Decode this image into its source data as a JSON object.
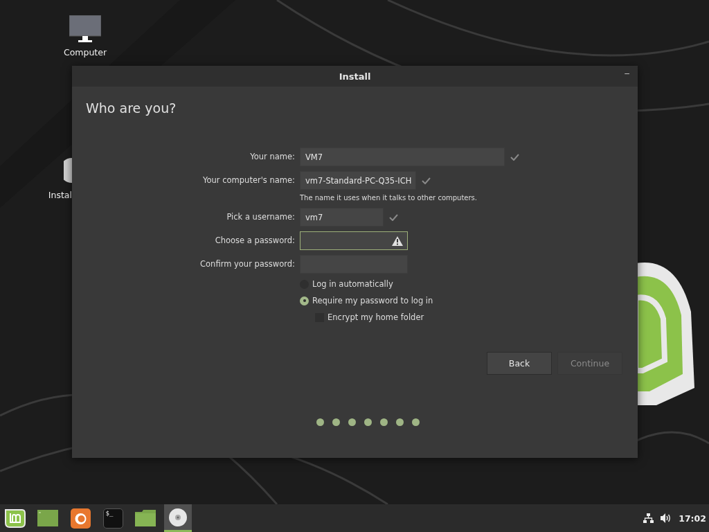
{
  "desktop_icons": [
    {
      "label": "Computer",
      "kind": "computer"
    },
    {
      "label": "Instal",
      "kind": "disc"
    }
  ],
  "window": {
    "title": "Install",
    "minimize": "–",
    "heading": "Who are you?",
    "fields": [
      {
        "label": "Your name:",
        "value": "VM7",
        "valid": true,
        "warning": false,
        "focused": false
      },
      {
        "label": "Your computer's name:",
        "value": "vm7-Standard-PC-Q35-ICH",
        "valid": true,
        "warning": false,
        "focused": false,
        "hint": "The name it uses when it talks to other computers."
      },
      {
        "label": "Pick a username:",
        "value": "vm7",
        "valid": true,
        "warning": false,
        "focused": false
      },
      {
        "label": "Choose a password:",
        "valid": false,
        "warning": true,
        "focused": true
      },
      {
        "label": "Confirm your password:",
        "valid": false,
        "warning": false,
        "focused": false
      }
    ],
    "login_options": [
      {
        "label": "Log in automatically",
        "kind": "radio",
        "selected": false
      },
      {
        "label": "Require my password to log in",
        "kind": "radio",
        "selected": true
      },
      {
        "label": "Encrypt my home folder",
        "kind": "checkbox",
        "checked": false
      }
    ],
    "buttons": [
      {
        "label": "Back",
        "disabled": false
      },
      {
        "label": "Continue",
        "disabled": true
      }
    ],
    "progress_dots": [
      {
        "done": true
      },
      {
        "done": true
      },
      {
        "done": true
      },
      {
        "done": true
      },
      {
        "done": true
      },
      {
        "done": true
      },
      {
        "done": true
      }
    ]
  },
  "taskbar": {
    "launchers": [
      {
        "kind": "menu",
        "active": false
      },
      {
        "kind": "desktop",
        "active": false
      },
      {
        "kind": "firefox",
        "active": false
      },
      {
        "kind": "terminal",
        "active": false
      },
      {
        "kind": "folder",
        "active": false
      },
      {
        "kind": "disc",
        "active": true
      }
    ],
    "terminal_glyph": "$_",
    "clock": "17:02"
  }
}
